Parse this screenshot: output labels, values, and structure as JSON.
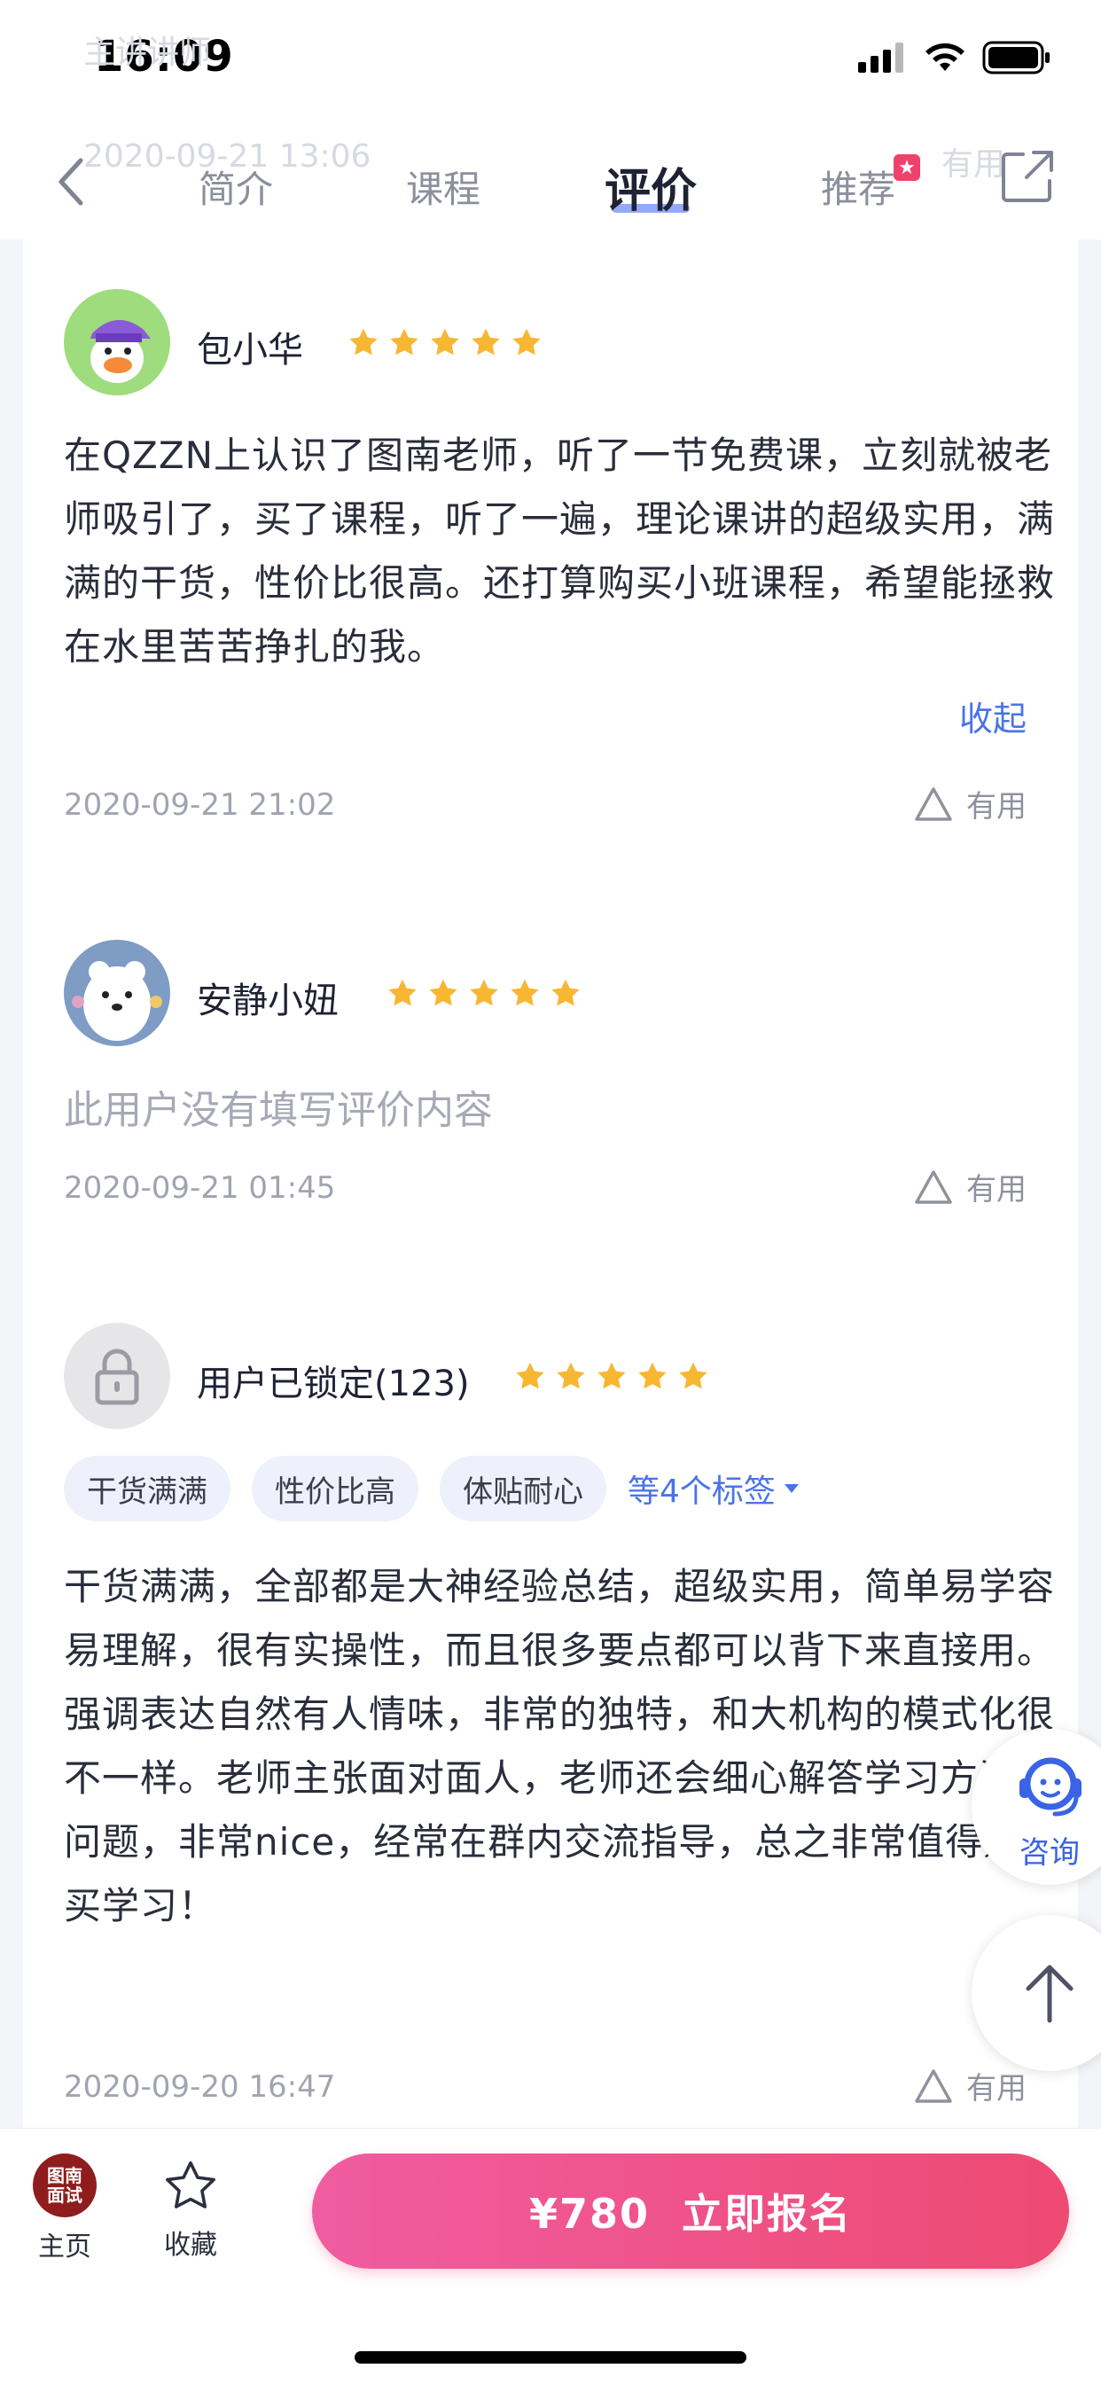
{
  "status_bar": {
    "time": "16:09"
  },
  "nav": {
    "ghost_top": "主讲讲师",
    "ghost_date": "2020-09-21 13:06",
    "ghost_useful": "有用",
    "tabs": [
      {
        "label": "简介",
        "active": false
      },
      {
        "label": "课程",
        "active": false
      },
      {
        "label": "评价",
        "active": true
      },
      {
        "label": "推荐",
        "active": false
      }
    ],
    "recommend_badge": "★"
  },
  "reviews": [
    {
      "user": "包小华",
      "rating": 5,
      "text": "在QZZN上认识了图南老师，听了一节免费课，立刻就被老师吸引了，买了课程，听了一遍，理论课讲的超级实用，满满的干货，性价比很高。还打算购买小班课程，希望能拯救在水里苦苦挣扎的我。",
      "toggle": "收起",
      "date": "2020-09-21 21:02",
      "useful": "有用"
    },
    {
      "user": "安静小妞",
      "rating": 5,
      "text": "此用户没有填写评价内容",
      "date": "2020-09-21 01:45",
      "useful": "有用"
    },
    {
      "user": "用户已锁定(123)",
      "rating": 5,
      "tags": [
        "干货满满",
        "性价比高",
        "体贴耐心"
      ],
      "more_tags": "等4个标签",
      "text": "干货满满，全部都是大神经验总结，超级实用，简单易学容易理解，很有实操性，而且很多要点都可以背下来直接用。强调表达自然有人情味，非常的独特，和大机构的模式化很不一样。老师主张面对面人，老师还会细心解答学习方法的问题，非常nice，经常在群内交流指导，总之非常值得购买学习！",
      "date": "2020-09-20 16:47",
      "useful": "有用"
    }
  ],
  "floating": {
    "consult_label": "咨询"
  },
  "bottom_bar": {
    "logo_text": "图南\n面试",
    "home_label": "主页",
    "fav_label": "收藏",
    "enroll_label": "¥780  立即报名"
  },
  "colors": {
    "accent": "#4a74e8",
    "star": "#f7b733",
    "enroll_start": "#f05ca1",
    "enroll_end": "#ee4a72"
  }
}
